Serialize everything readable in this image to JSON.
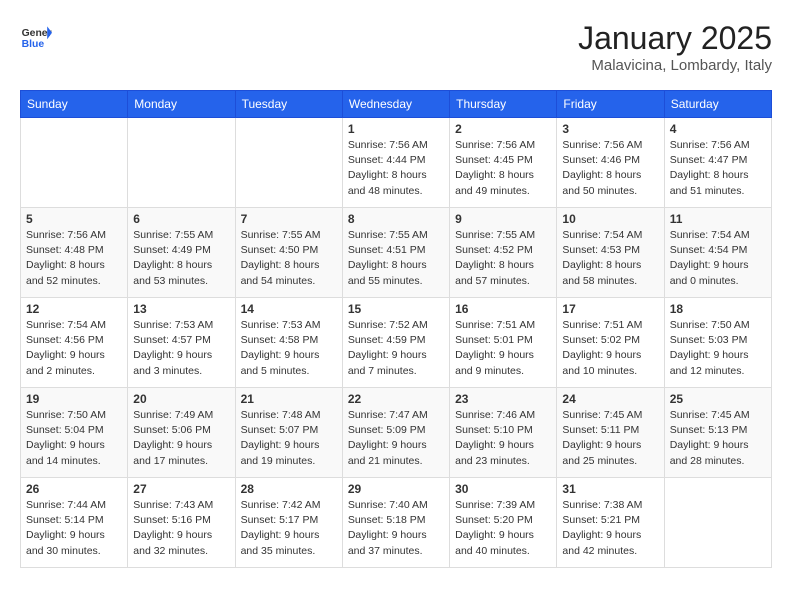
{
  "logo": {
    "general": "General",
    "blue": "Blue"
  },
  "header": {
    "month": "January 2025",
    "location": "Malavicina, Lombardy, Italy"
  },
  "weekdays": [
    "Sunday",
    "Monday",
    "Tuesday",
    "Wednesday",
    "Thursday",
    "Friday",
    "Saturday"
  ],
  "weeks": [
    [
      {
        "day": null
      },
      {
        "day": null
      },
      {
        "day": null
      },
      {
        "day": 1,
        "sunrise": "Sunrise: 7:56 AM",
        "sunset": "Sunset: 4:44 PM",
        "daylight": "Daylight: 8 hours and 48 minutes."
      },
      {
        "day": 2,
        "sunrise": "Sunrise: 7:56 AM",
        "sunset": "Sunset: 4:45 PM",
        "daylight": "Daylight: 8 hours and 49 minutes."
      },
      {
        "day": 3,
        "sunrise": "Sunrise: 7:56 AM",
        "sunset": "Sunset: 4:46 PM",
        "daylight": "Daylight: 8 hours and 50 minutes."
      },
      {
        "day": 4,
        "sunrise": "Sunrise: 7:56 AM",
        "sunset": "Sunset: 4:47 PM",
        "daylight": "Daylight: 8 hours and 51 minutes."
      }
    ],
    [
      {
        "day": 5,
        "sunrise": "Sunrise: 7:56 AM",
        "sunset": "Sunset: 4:48 PM",
        "daylight": "Daylight: 8 hours and 52 minutes."
      },
      {
        "day": 6,
        "sunrise": "Sunrise: 7:55 AM",
        "sunset": "Sunset: 4:49 PM",
        "daylight": "Daylight: 8 hours and 53 minutes."
      },
      {
        "day": 7,
        "sunrise": "Sunrise: 7:55 AM",
        "sunset": "Sunset: 4:50 PM",
        "daylight": "Daylight: 8 hours and 54 minutes."
      },
      {
        "day": 8,
        "sunrise": "Sunrise: 7:55 AM",
        "sunset": "Sunset: 4:51 PM",
        "daylight": "Daylight: 8 hours and 55 minutes."
      },
      {
        "day": 9,
        "sunrise": "Sunrise: 7:55 AM",
        "sunset": "Sunset: 4:52 PM",
        "daylight": "Daylight: 8 hours and 57 minutes."
      },
      {
        "day": 10,
        "sunrise": "Sunrise: 7:54 AM",
        "sunset": "Sunset: 4:53 PM",
        "daylight": "Daylight: 8 hours and 58 minutes."
      },
      {
        "day": 11,
        "sunrise": "Sunrise: 7:54 AM",
        "sunset": "Sunset: 4:54 PM",
        "daylight": "Daylight: 9 hours and 0 minutes."
      }
    ],
    [
      {
        "day": 12,
        "sunrise": "Sunrise: 7:54 AM",
        "sunset": "Sunset: 4:56 PM",
        "daylight": "Daylight: 9 hours and 2 minutes."
      },
      {
        "day": 13,
        "sunrise": "Sunrise: 7:53 AM",
        "sunset": "Sunset: 4:57 PM",
        "daylight": "Daylight: 9 hours and 3 minutes."
      },
      {
        "day": 14,
        "sunrise": "Sunrise: 7:53 AM",
        "sunset": "Sunset: 4:58 PM",
        "daylight": "Daylight: 9 hours and 5 minutes."
      },
      {
        "day": 15,
        "sunrise": "Sunrise: 7:52 AM",
        "sunset": "Sunset: 4:59 PM",
        "daylight": "Daylight: 9 hours and 7 minutes."
      },
      {
        "day": 16,
        "sunrise": "Sunrise: 7:51 AM",
        "sunset": "Sunset: 5:01 PM",
        "daylight": "Daylight: 9 hours and 9 minutes."
      },
      {
        "day": 17,
        "sunrise": "Sunrise: 7:51 AM",
        "sunset": "Sunset: 5:02 PM",
        "daylight": "Daylight: 9 hours and 10 minutes."
      },
      {
        "day": 18,
        "sunrise": "Sunrise: 7:50 AM",
        "sunset": "Sunset: 5:03 PM",
        "daylight": "Daylight: 9 hours and 12 minutes."
      }
    ],
    [
      {
        "day": 19,
        "sunrise": "Sunrise: 7:50 AM",
        "sunset": "Sunset: 5:04 PM",
        "daylight": "Daylight: 9 hours and 14 minutes."
      },
      {
        "day": 20,
        "sunrise": "Sunrise: 7:49 AM",
        "sunset": "Sunset: 5:06 PM",
        "daylight": "Daylight: 9 hours and 17 minutes."
      },
      {
        "day": 21,
        "sunrise": "Sunrise: 7:48 AM",
        "sunset": "Sunset: 5:07 PM",
        "daylight": "Daylight: 9 hours and 19 minutes."
      },
      {
        "day": 22,
        "sunrise": "Sunrise: 7:47 AM",
        "sunset": "Sunset: 5:09 PM",
        "daylight": "Daylight: 9 hours and 21 minutes."
      },
      {
        "day": 23,
        "sunrise": "Sunrise: 7:46 AM",
        "sunset": "Sunset: 5:10 PM",
        "daylight": "Daylight: 9 hours and 23 minutes."
      },
      {
        "day": 24,
        "sunrise": "Sunrise: 7:45 AM",
        "sunset": "Sunset: 5:11 PM",
        "daylight": "Daylight: 9 hours and 25 minutes."
      },
      {
        "day": 25,
        "sunrise": "Sunrise: 7:45 AM",
        "sunset": "Sunset: 5:13 PM",
        "daylight": "Daylight: 9 hours and 28 minutes."
      }
    ],
    [
      {
        "day": 26,
        "sunrise": "Sunrise: 7:44 AM",
        "sunset": "Sunset: 5:14 PM",
        "daylight": "Daylight: 9 hours and 30 minutes."
      },
      {
        "day": 27,
        "sunrise": "Sunrise: 7:43 AM",
        "sunset": "Sunset: 5:16 PM",
        "daylight": "Daylight: 9 hours and 32 minutes."
      },
      {
        "day": 28,
        "sunrise": "Sunrise: 7:42 AM",
        "sunset": "Sunset: 5:17 PM",
        "daylight": "Daylight: 9 hours and 35 minutes."
      },
      {
        "day": 29,
        "sunrise": "Sunrise: 7:40 AM",
        "sunset": "Sunset: 5:18 PM",
        "daylight": "Daylight: 9 hours and 37 minutes."
      },
      {
        "day": 30,
        "sunrise": "Sunrise: 7:39 AM",
        "sunset": "Sunset: 5:20 PM",
        "daylight": "Daylight: 9 hours and 40 minutes."
      },
      {
        "day": 31,
        "sunrise": "Sunrise: 7:38 AM",
        "sunset": "Sunset: 5:21 PM",
        "daylight": "Daylight: 9 hours and 42 minutes."
      },
      {
        "day": null
      }
    ]
  ]
}
